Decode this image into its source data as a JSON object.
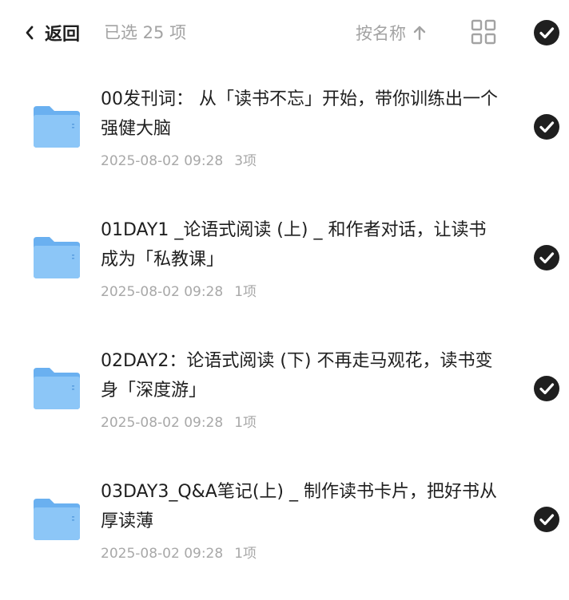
{
  "header": {
    "back_label": "返回",
    "selected_text": "已选 25 项",
    "sort_label": "按名称"
  },
  "files": [
    {
      "title": "00发刊词： 从「读书不忘」开始，带你训练出一个强健大脑",
      "date": "2025-08-02 09:28",
      "count": "3项",
      "checked": true
    },
    {
      "title": "01DAY1 _论语式阅读 (上) _ 和作者对话，让读书成为「私教课」",
      "date": "2025-08-02 09:28",
      "count": "1项",
      "checked": true
    },
    {
      "title": "02DAY2：论语式阅读 (下) 不再走马观花，读书变身「深度游」",
      "date": "2025-08-02 09:28",
      "count": "1项",
      "checked": true
    },
    {
      "title": "03DAY3_Q&A笔记(上) _ 制作读书卡片，把好书从厚读薄",
      "date": "2025-08-02 09:28",
      "count": "1项",
      "checked": true
    }
  ],
  "colors": {
    "text": "#1f1f1f",
    "muted": "#a3a3a3",
    "folder_back": "#6ab0f0",
    "folder_front": "#8cc6f7",
    "check": "#1f1f1f"
  }
}
